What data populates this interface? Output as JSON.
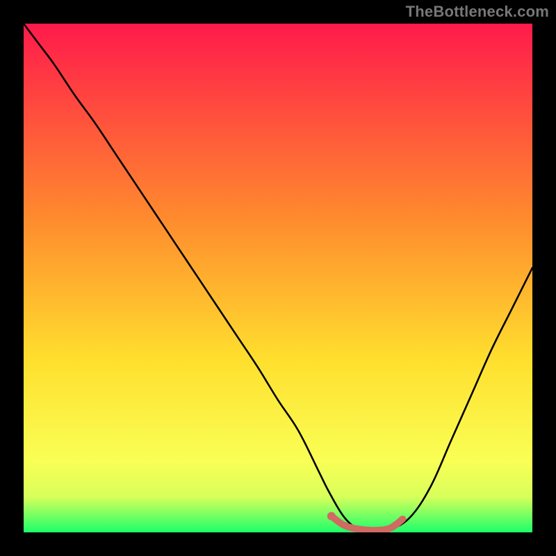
{
  "attribution": "TheBottleneck.com",
  "colors": {
    "page_bg": "#000000",
    "gradient_top": "#ff1a4b",
    "gradient_mid1": "#ff6a2e",
    "gradient_mid2": "#ffdf2e",
    "gradient_mid3": "#f9ff55",
    "gradient_bottom": "#1cff6a",
    "curve": "#000000",
    "highlight": "#d06a62"
  },
  "chart_data": {
    "type": "line",
    "title": "",
    "xlabel": "",
    "ylabel": "",
    "xlim": [
      0,
      100
    ],
    "ylim": [
      0,
      100
    ],
    "series": [
      {
        "name": "bottleneck-curve",
        "x": [
          0,
          3,
          6,
          10,
          14,
          18,
          22,
          26,
          30,
          34,
          38,
          42,
          46,
          50,
          54,
          58,
          60,
          63,
          66,
          69,
          72,
          76,
          80,
          84,
          88,
          92,
          96,
          100
        ],
        "y": [
          100,
          96,
          92,
          86,
          80.5,
          74.5,
          68.5,
          62.5,
          56.5,
          50.5,
          44.5,
          38.5,
          32.5,
          26,
          20,
          12,
          8,
          3,
          0.5,
          0,
          0.5,
          3,
          9,
          18,
          27,
          36,
          44,
          52
        ]
      }
    ],
    "highlight_segment": {
      "name": "optimal-range",
      "x": [
        60.5,
        63,
        66,
        69,
        72,
        74.5
      ],
      "y": [
        3.2,
        1.4,
        0.6,
        0.4,
        0.8,
        2.6
      ]
    }
  }
}
